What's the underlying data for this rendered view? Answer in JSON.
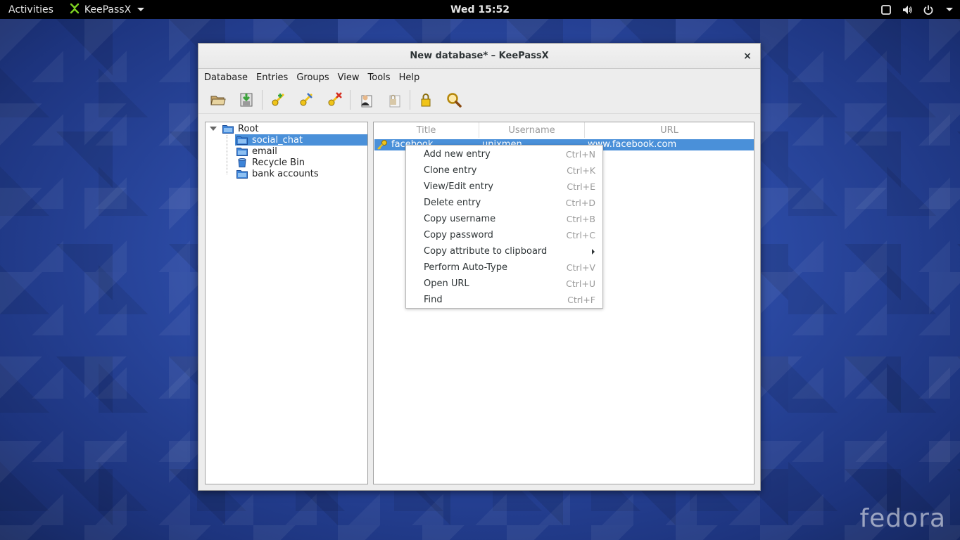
{
  "topbar": {
    "activities": "Activities",
    "app_name": "KeePassX",
    "clock": "Wed 15:52"
  },
  "window": {
    "title": "New database* – KeePassX",
    "close_glyph": "×"
  },
  "menubar": [
    "Database",
    "Entries",
    "Groups",
    "View",
    "Tools",
    "Help"
  ],
  "toolbar": {
    "buttons": [
      "open-database-icon",
      "save-database-icon",
      "add-entry-icon",
      "edit-entry-icon",
      "delete-entry-icon",
      "copy-username-icon",
      "copy-password-icon",
      "lock-database-icon",
      "search-icon"
    ]
  },
  "tree": {
    "root": "Root",
    "groups": [
      "social_chat",
      "email",
      "Recycle Bin",
      "bank accounts"
    ],
    "selected": "social_chat"
  },
  "entries": {
    "columns": [
      "Title",
      "Username",
      "URL"
    ],
    "rows": [
      {
        "title": "facebook",
        "username": "unixmen",
        "url": "www.facebook.com"
      }
    ]
  },
  "context_menu": {
    "items": [
      {
        "label": "Add new entry",
        "shortcut": "Ctrl+N"
      },
      {
        "label": "Clone entry",
        "shortcut": "Ctrl+K"
      },
      {
        "label": "View/Edit entry",
        "shortcut": "Ctrl+E"
      },
      {
        "label": "Delete entry",
        "shortcut": "Ctrl+D"
      },
      {
        "label": "Copy username",
        "shortcut": "Ctrl+B"
      },
      {
        "label": "Copy password",
        "shortcut": "Ctrl+C"
      },
      {
        "label": "Copy attribute to clipboard",
        "shortcut": ""
      },
      {
        "label": "Perform Auto-Type",
        "shortcut": "Ctrl+V"
      },
      {
        "label": "Open URL",
        "shortcut": "Ctrl+U"
      },
      {
        "label": "Find",
        "shortcut": "Ctrl+F"
      }
    ]
  },
  "desktop": {
    "brand": "fedora"
  },
  "colors": {
    "selection": "#4a90d9",
    "topbar": "#000000",
    "wallpaper": "#2c4ba6"
  }
}
